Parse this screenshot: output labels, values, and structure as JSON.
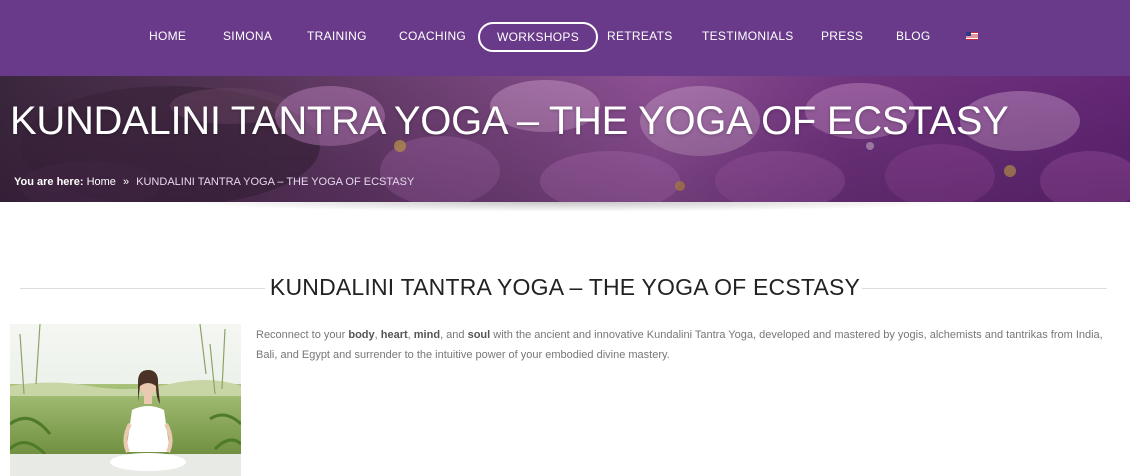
{
  "nav": {
    "items": [
      {
        "label": "HOME"
      },
      {
        "label": "SIMONA"
      },
      {
        "label": "TRAINING"
      },
      {
        "label": "COACHING"
      },
      {
        "label": "WORKSHOPS",
        "active": true
      },
      {
        "label": "RETREATS"
      },
      {
        "label": "TESTIMONIALS"
      },
      {
        "label": "PRESS"
      },
      {
        "label": "BLOG"
      }
    ],
    "language_icon": "us-flag-icon"
  },
  "hero": {
    "title": "KUNDALINI TANTRA YOGA – THE YOGA OF ECSTASY",
    "breadcrumb": {
      "label": "You are here:",
      "home": "Home",
      "separator": "»",
      "current": "KUNDALINI TANTRA YOGA – THE YOGA OF ECSTASY"
    }
  },
  "content": {
    "section_title": "KUNDALINI TANTRA YOGA – THE YOGA OF ECSTASY",
    "intro": {
      "t1": "Reconnect to your ",
      "b1": "body",
      "t2": ", ",
      "b2": "heart",
      "t3": ", ",
      "b3": "mind",
      "t4": ", and ",
      "b4": "soul",
      "t5": " with the ancient and innovative Kundalini Tantra Yoga, developed and mastered by yogis, alchemists and tantrikas from India, Bali, and Egypt and surrender to the intuitive power of your embodied divine mastery."
    }
  },
  "colors": {
    "nav_bg": "#6a3a8a",
    "text_dark": "#222222",
    "text_body": "#777777"
  }
}
